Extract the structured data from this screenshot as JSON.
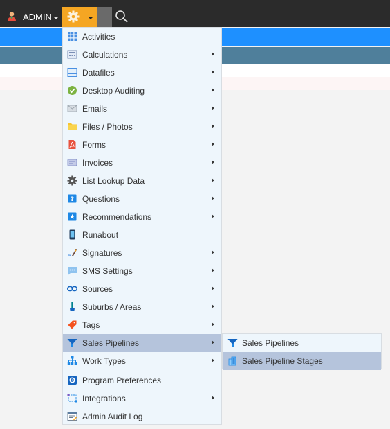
{
  "topbar": {
    "admin_label": "ADMIN",
    "icons": {
      "user": "user-icon",
      "settings": "gear-icon",
      "search": "search-icon"
    }
  },
  "colors": {
    "topbar": "#2b2b2b",
    "settings_button": "#f5a623",
    "band_blue": "#1e90ff",
    "band_steel": "#4f7f9b",
    "menu_bg": "#eef6fc",
    "active_item": "#b5c4dc"
  },
  "menu": {
    "items": [
      {
        "label": "Activities",
        "icon": "grid-icon",
        "submenu": false
      },
      {
        "label": "Calculations",
        "icon": "calculator-icon",
        "submenu": true
      },
      {
        "label": "Datafiles",
        "icon": "table-icon",
        "submenu": true
      },
      {
        "label": "Desktop Auditing",
        "icon": "check-circle-icon",
        "submenu": true
      },
      {
        "label": "Emails",
        "icon": "envelope-icon",
        "submenu": true
      },
      {
        "label": "Files / Photos",
        "icon": "folder-icon",
        "submenu": true
      },
      {
        "label": "Forms",
        "icon": "pdf-icon",
        "submenu": true
      },
      {
        "label": "Invoices",
        "icon": "invoice-icon",
        "submenu": true
      },
      {
        "label": "List Lookup Data",
        "icon": "cog-icon",
        "submenu": true
      },
      {
        "label": "Questions",
        "icon": "question-icon",
        "submenu": true
      },
      {
        "label": "Recommendations",
        "icon": "star-badge-icon",
        "submenu": true
      },
      {
        "label": "Runabout",
        "icon": "mobile-icon",
        "submenu": false
      },
      {
        "label": "Signatures",
        "icon": "pen-icon",
        "submenu": true
      },
      {
        "label": "SMS Settings",
        "icon": "chat-icon",
        "submenu": true
      },
      {
        "label": "Sources",
        "icon": "link-icon",
        "submenu": true
      },
      {
        "label": "Suburbs / Areas",
        "icon": "brush-icon",
        "submenu": true
      },
      {
        "label": "Tags",
        "icon": "tag-icon",
        "submenu": true
      },
      {
        "label": "Sales Pipelines",
        "icon": "funnel-icon",
        "submenu": true,
        "active": true
      },
      {
        "label": "Work Types",
        "icon": "hierarchy-icon",
        "submenu": true
      },
      {
        "label": "Program Preferences",
        "icon": "settings-square-icon",
        "submenu": false
      },
      {
        "label": "Integrations",
        "icon": "integration-icon",
        "submenu": true
      },
      {
        "label": "Admin Audit Log",
        "icon": "audit-log-icon",
        "submenu": false
      }
    ]
  },
  "submenu": {
    "items": [
      {
        "label": "Sales Pipelines",
        "icon": "funnel-icon"
      },
      {
        "label": "Sales Pipeline Stages",
        "icon": "stages-icon",
        "active": true
      }
    ]
  }
}
